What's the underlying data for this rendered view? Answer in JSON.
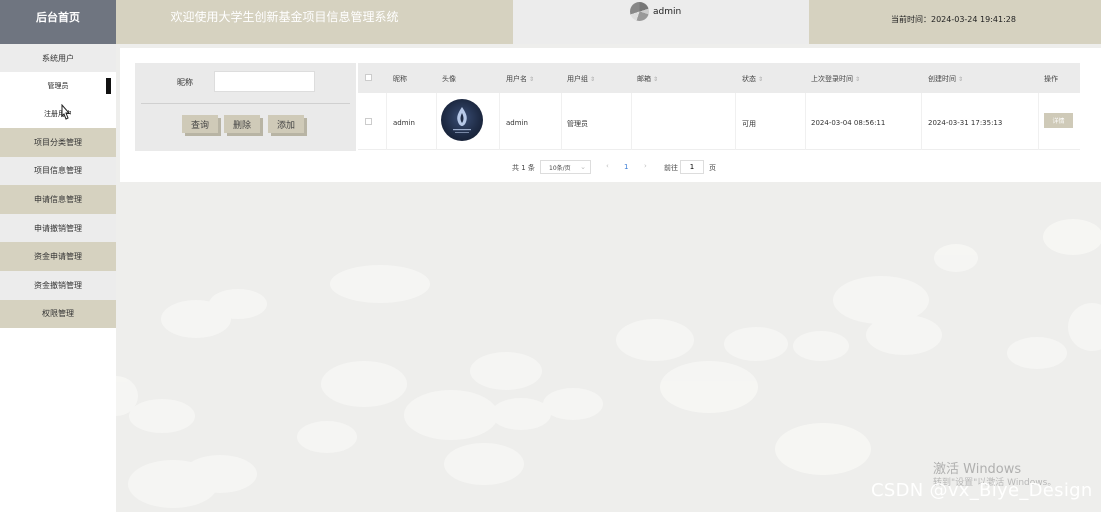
{
  "header": {
    "brand": "后台首页",
    "title": "欢迎使用大学生创新基金项目信息管理系统",
    "user": "admin",
    "time": "当前时间：2024-03-24 19:41:28"
  },
  "sidebar": {
    "items": [
      {
        "label": "系统用户"
      },
      {
        "label": "管理员"
      },
      {
        "label": "注册用户"
      },
      {
        "label": "项目分类管理"
      },
      {
        "label": "项目信息管理"
      },
      {
        "label": "申请信息管理"
      },
      {
        "label": "申请撤销管理"
      },
      {
        "label": "资金申请管理"
      },
      {
        "label": "资金撤销管理"
      },
      {
        "label": "权限管理"
      }
    ]
  },
  "search": {
    "label": "昵称",
    "value": "",
    "query": "查询",
    "delete": "删除",
    "add": "添加"
  },
  "table": {
    "headers": [
      "昵称",
      "头像",
      "用户名",
      "用户组",
      "邮箱",
      "状态",
      "上次登录时间",
      "创建时间",
      "操作"
    ],
    "rows": [
      {
        "nickname": "admin",
        "username": "admin",
        "group": "管理员",
        "email": "",
        "status": "可用",
        "last_login": "2024-03-04 08:56:11",
        "created": "2024-03-31 17:35:13",
        "action": "详情"
      }
    ]
  },
  "pager": {
    "total": "共 1 条",
    "size": "10条/页",
    "prev": "‹",
    "page": "1",
    "next": "›",
    "goto": "前往",
    "goto_value": "1",
    "suffix": "页"
  },
  "watermarks": {
    "activate": "激活 Windows",
    "activate_hint": "转到\"设置\"以激活 Windows。",
    "csdn": "CSDN @vx_Biye_Design"
  }
}
